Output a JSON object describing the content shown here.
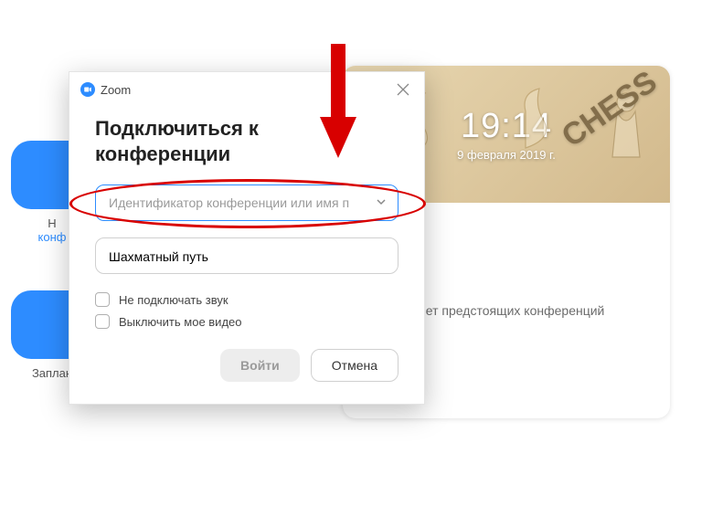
{
  "background": {
    "top_item_line1": "Н",
    "top_item_line2": "конф",
    "bottom_item_label": "Заплан"
  },
  "right_card": {
    "time": "19:14",
    "date": "9 февраля 2019 г.",
    "hero_text": "CHESS",
    "empty_msg": "я нет предстоящих конференций"
  },
  "dialog": {
    "app_name": "Zoom",
    "title_line": "Подключиться к конференции",
    "id_placeholder": "Идентификатор конференции или имя п",
    "name_value": "Шахматный путь",
    "checkbox1": "Не подключать звук",
    "checkbox2": "Выключить мое видео",
    "btn_join": "Войти",
    "btn_cancel": "Отмена"
  }
}
